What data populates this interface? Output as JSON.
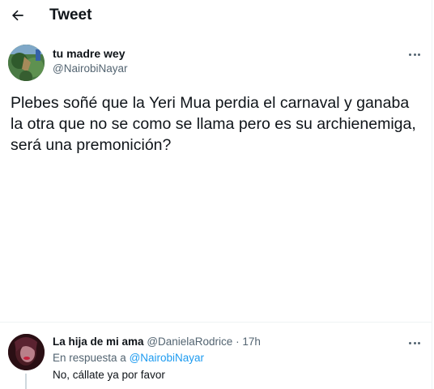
{
  "header": {
    "title": "Tweet",
    "back_icon": "arrow-left-icon"
  },
  "tweet": {
    "author_name": "tu madre wey",
    "author_handle": "@NairobiNayar",
    "more_icon": "more-horizontal-icon",
    "text": "Plebes soñé que la Yeri Mua perdia el carnaval y ganaba la otra que no se como se llama pero es su archienemiga, será una premonición?"
  },
  "reply": {
    "author_name": "La hija de mi ama",
    "author_handle": "@DanielaRodrice",
    "separator": " · ",
    "time": "17h",
    "replying_prefix": "En respuesta a ",
    "replying_to": "@NairobiNayar",
    "text": "No, cállate ya por favor",
    "more_icon": "more-horizontal-icon"
  },
  "colors": {
    "text": "#0f1419",
    "secondary": "#536471",
    "link": "#1d9bf0",
    "divider": "#eff3f4"
  }
}
